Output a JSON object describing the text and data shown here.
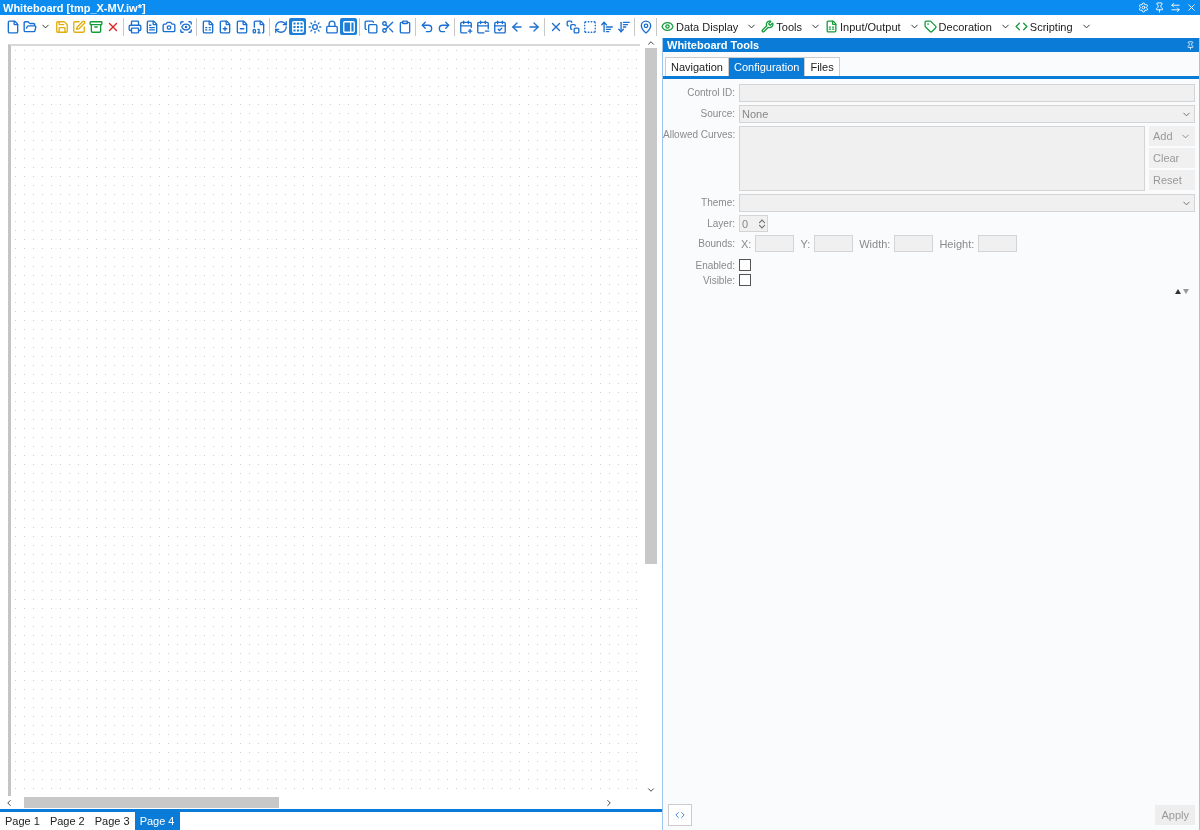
{
  "window": {
    "title": "Whiteboard [tmp_X-MV.iw*]"
  },
  "toolbar": {
    "buttons": [
      {
        "selected": false
      },
      {
        "selected": false
      },
      {
        "selected": false
      },
      {
        "selected": false
      },
      {
        "selected": false
      },
      {
        "selected": false
      },
      {
        "selected": false
      },
      {
        "selected": false
      },
      {
        "selected": false
      },
      {
        "selected": false
      },
      {
        "selected": false
      },
      {
        "selected": false
      },
      {
        "selected": false
      },
      {
        "selected": false
      },
      {
        "selected": false
      },
      {
        "selected": true
      },
      {
        "selected": false
      },
      {
        "selected": false
      },
      {
        "selected": true
      },
      {
        "selected": false
      },
      {
        "selected": false
      },
      {
        "selected": false
      },
      {
        "selected": false
      },
      {
        "selected": false
      },
      {
        "selected": false
      },
      {
        "selected": false
      },
      {
        "selected": false
      },
      {
        "selected": false
      },
      {
        "selected": false
      },
      {
        "selected": false
      },
      {
        "selected": false
      },
      {
        "selected": false
      },
      {
        "selected": false
      },
      {
        "selected": false
      },
      {
        "selected": false
      }
    ],
    "menus": [
      {
        "label": "Data Display"
      },
      {
        "label": "Tools"
      },
      {
        "label": "Input/Output"
      },
      {
        "label": "Decoration"
      },
      {
        "label": "Scripting"
      }
    ]
  },
  "page_tabs": [
    {
      "label": "Page 1",
      "selected": false
    },
    {
      "label": "Page 2",
      "selected": false
    },
    {
      "label": "Page 3",
      "selected": false
    },
    {
      "label": "Page 4",
      "selected": true
    }
  ],
  "panel": {
    "title": "Whiteboard Tools",
    "tabs": [
      {
        "label": "Navigation",
        "selected": false
      },
      {
        "label": "Configuration",
        "selected": true
      },
      {
        "label": "Files",
        "selected": false
      }
    ],
    "fields": [
      {
        "kind": "text",
        "label": "Control ID:"
      },
      {
        "kind": "select",
        "label": "Source:",
        "value": "None"
      },
      {
        "kind": "list",
        "label": "Allowed Curves:",
        "buttons": [
          {
            "label": "Add",
            "dropdown": true
          },
          {
            "label": "Clear",
            "dropdown": false
          },
          {
            "label": "Reset",
            "dropdown": false
          }
        ]
      },
      {
        "kind": "select",
        "label": "Theme:"
      },
      {
        "kind": "spin",
        "label": "Layer:",
        "value": "0"
      },
      {
        "kind": "bounds",
        "label": "Bounds:",
        "parts": [
          "X:",
          "Y:",
          "Width:",
          "Height:"
        ]
      },
      {
        "kind": "check",
        "label": "Enabled:",
        "checked": false
      },
      {
        "kind": "check",
        "label": "Visible:",
        "checked": false
      }
    ],
    "apply": "Apply"
  }
}
